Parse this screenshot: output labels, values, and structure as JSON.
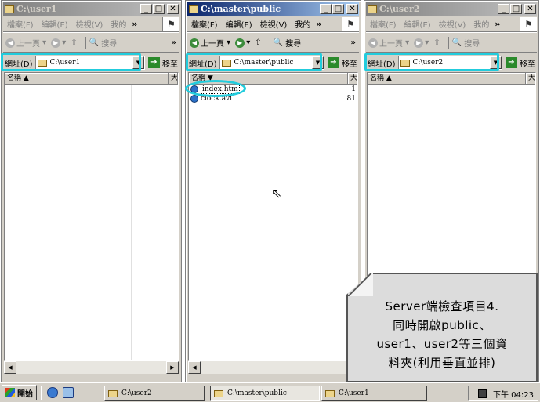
{
  "windows": [
    {
      "title": "C:\\user1",
      "state": "inactive",
      "menu": [
        "檔案(F)",
        "編輯(E)",
        "檢視(V)",
        "我的"
      ],
      "toolbar": {
        "back": "上一頁",
        "search": "搜尋"
      },
      "address_label": "網址(D)",
      "address_value": "C:\\user1",
      "go_label": "移至",
      "columns": [
        "名稱",
        "大"
      ],
      "files": []
    },
    {
      "title": "C:\\master\\public",
      "state": "active",
      "menu": [
        "檔案(F)",
        "編輯(E)",
        "檢視(V)",
        "我的"
      ],
      "toolbar": {
        "back": "上一頁",
        "search": "搜尋"
      },
      "address_label": "網址(D)",
      "address_value": "C:\\master\\public",
      "go_label": "移至",
      "columns": [
        "名稱",
        "大"
      ],
      "files": [
        {
          "name": "index.htm",
          "size": "1"
        },
        {
          "name": "clock.avi",
          "size": "81"
        }
      ]
    },
    {
      "title": "C:\\user2",
      "state": "inactive",
      "menu": [
        "檔案(F)",
        "編輯(E)",
        "檢視(V)",
        "我的"
      ],
      "toolbar": {
        "back": "上一頁",
        "search": "搜尋"
      },
      "address_label": "網址(D)",
      "address_value": "C:\\user2",
      "go_label": "移至",
      "columns": [
        "名稱",
        "大"
      ],
      "files": []
    }
  ],
  "taskbar": {
    "start_label": "開始",
    "tasks": [
      "C:\\user2",
      "C:\\master\\public",
      "C:\\user1"
    ],
    "clock": "下午 04:23"
  },
  "callout": {
    "lines": [
      "Server端檢查項目4.",
      "同時開啟public、",
      "user1、user2等三個資",
      "料夾(利用垂直並排)"
    ]
  },
  "colors": {
    "highlight": "#22ccdd",
    "active_title": "#0a246a",
    "inactive_title": "#808080"
  }
}
